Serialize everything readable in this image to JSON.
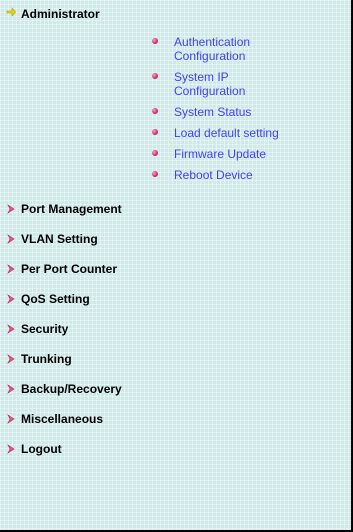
{
  "menu": {
    "admin": {
      "label": "Administrator",
      "icon": "expanded-arrow-icon",
      "icon_color": "#d6c400",
      "items": [
        {
          "label": "Authentication\nConfiguration"
        },
        {
          "label": "System IP\nConfiguration"
        },
        {
          "label": "System Status"
        },
        {
          "label": "Load default setting"
        },
        {
          "label": "Firmware Update"
        },
        {
          "label": "Reboot Device"
        }
      ]
    },
    "sections": [
      {
        "label": "Port Management",
        "icon": "collapsed-arrow-icon"
      },
      {
        "label": "VLAN Setting",
        "icon": "collapsed-arrow-icon"
      },
      {
        "label": "Per Port Counter",
        "icon": "collapsed-arrow-icon"
      },
      {
        "label": "QoS Setting",
        "icon": "collapsed-arrow-icon"
      },
      {
        "label": "Security",
        "icon": "collapsed-arrow-icon"
      },
      {
        "label": "Trunking",
        "icon": "collapsed-arrow-icon"
      },
      {
        "label": "Backup/Recovery",
        "icon": "collapsed-arrow-icon"
      },
      {
        "label": "Miscellaneous",
        "icon": "collapsed-arrow-icon"
      },
      {
        "label": "Logout",
        "icon": "collapsed-arrow-icon"
      }
    ]
  },
  "colors": {
    "background": "#cfe9e9",
    "link": "#3f41ff",
    "bullet": "#d8306a",
    "collapsed_arrow": "#e05a7a"
  }
}
